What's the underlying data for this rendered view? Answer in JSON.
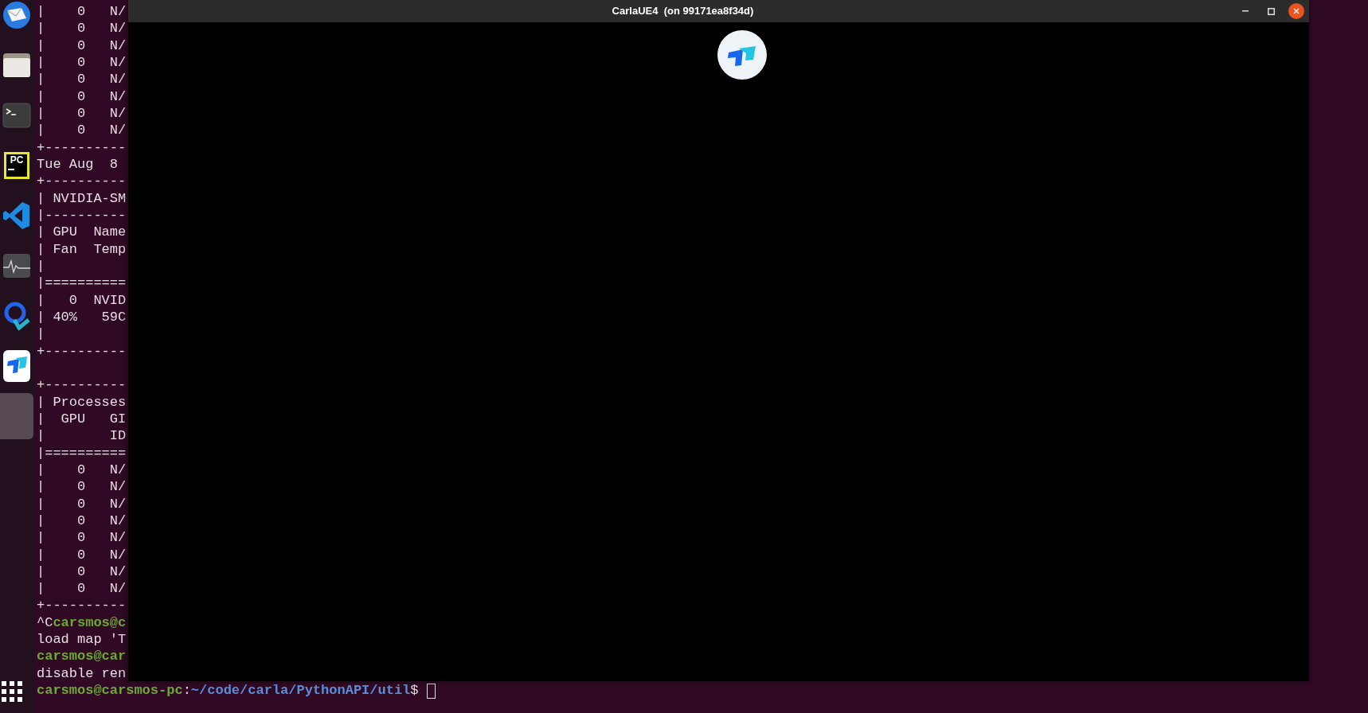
{
  "dock": {
    "items": [
      {
        "kind": "mail",
        "selected": false
      },
      {
        "kind": "files",
        "selected": false
      },
      {
        "kind": "terminal",
        "selected": false
      },
      {
        "kind": "pycharm",
        "selected": false,
        "logo_text": "PC"
      },
      {
        "kind": "vscode",
        "selected": false
      },
      {
        "kind": "monitor",
        "selected": false
      },
      {
        "kind": "q-app",
        "selected": false
      },
      {
        "kind": "remote",
        "selected": false
      },
      {
        "kind": "empty",
        "selected": true
      }
    ]
  },
  "terminal": {
    "lines": [
      {
        "text": "|    0   N/"
      },
      {
        "text": "|    0   N/"
      },
      {
        "text": "|    0   N/"
      },
      {
        "text": "|    0   N/"
      },
      {
        "text": "|    0   N/"
      },
      {
        "text": "|    0   N/"
      },
      {
        "text": "|    0   N/"
      },
      {
        "text": "|    0   N/"
      },
      {
        "text": "+----------"
      },
      {
        "text": "Tue Aug  8"
      },
      {
        "text": "+----------"
      },
      {
        "text": "| NVIDIA-SM"
      },
      {
        "text": "|----------"
      },
      {
        "text": "| GPU  Name"
      },
      {
        "text": "| Fan  Temp"
      },
      {
        "text": "|"
      },
      {
        "text": "|=========="
      },
      {
        "text": "|   0  NVID"
      },
      {
        "text": "| 40%   59C"
      },
      {
        "text": "|"
      },
      {
        "text": "+----------"
      },
      {
        "text": "+----------",
        "gap_before": true
      },
      {
        "text": "| Processes"
      },
      {
        "text": "|  GPU   GI"
      },
      {
        "text": "|        ID"
      },
      {
        "text": "|=========="
      },
      {
        "text": "|    0   N/"
      },
      {
        "text": "|    0   N/"
      },
      {
        "text": "|    0   N/"
      },
      {
        "text": "|    0   N/"
      },
      {
        "text": "|    0   N/"
      },
      {
        "text": "|    0   N/"
      },
      {
        "text": "|    0   N/"
      },
      {
        "text": "|    0   N/"
      },
      {
        "text": "+----------"
      },
      {
        "segments": [
          {
            "kind": "plain",
            "text": "^C"
          },
          {
            "kind": "user",
            "text": "carsmos@c"
          }
        ]
      },
      {
        "text": "load map 'T"
      },
      {
        "segments": [
          {
            "kind": "user",
            "text": "carsmos@car"
          }
        ]
      },
      {
        "text": "disable ren"
      },
      {
        "segments": [
          {
            "kind": "user",
            "text": "carsmos@carsmos-pc"
          },
          {
            "kind": "plain",
            "text": ":"
          },
          {
            "kind": "path",
            "text": "~/code/carla/PythonAPI/util"
          },
          {
            "kind": "plain",
            "text": "$"
          }
        ],
        "cursor": true
      }
    ]
  },
  "window": {
    "title": "CarlaUE4  (on 99171ea8f34d)"
  }
}
